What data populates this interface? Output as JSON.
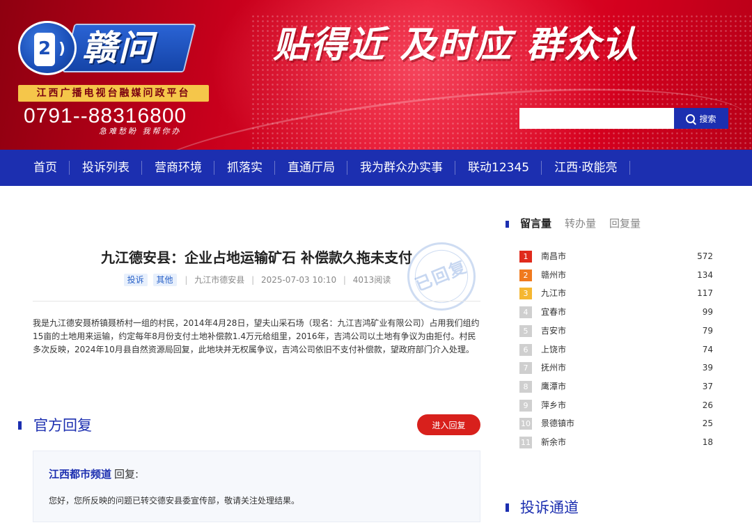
{
  "header": {
    "logo_num": "2",
    "logo_text": "赣问",
    "platform": "江西广播电视台融媒问政平台",
    "hotline": "0791--88316800",
    "hotline_sub": "急难愁盼  我帮你办",
    "slogan": "贴得近  及时应  群众认",
    "search": {
      "placeholder": "",
      "button_label": "搜索"
    }
  },
  "nav": [
    "首页",
    "投诉列表",
    "营商环境",
    "抓落实",
    "直通厅局",
    "我为群众办实事",
    "联动12345",
    "江西·政能亮"
  ],
  "article": {
    "title": "九江德安县：企业占地运输矿石 补偿款久拖未支付",
    "tags": [
      "投诉",
      "其他"
    ],
    "location": "九江市德安县",
    "datetime": "2025-07-03 10:10",
    "reads": "4013阅读",
    "stamp": "已回复",
    "body": "我是九江德安聂桥镇聂桥村一组的村民，2014年4月28日，望夫山采石场（现名：九江吉鸿矿业有限公司）占用我们组约15亩的土地用来运输，约定每年8月份支付土地补偿款1.4万元给组里，2016年，吉鸿公司以土地有争议为由拒付。村民多次反映，2024年10月县自然资源局回复，此地块并无权属争议，吉鸿公司依旧不支付补偿款，望政府部门介入处理。"
  },
  "official_reply": {
    "section_title": "官方回复",
    "button_label": "进入回复",
    "org": "江西都市频道",
    "reply_label": "回复:",
    "text": "您好，您所反映的问题已转交德安县委宣传部，敬请关注处理结果。"
  },
  "stats": {
    "tabs": [
      "留言量",
      "转办量",
      "回复量"
    ],
    "active_tab": 0,
    "ranking": [
      {
        "rank": "1",
        "city": "南昌市",
        "count": "572",
        "color": "#e02a1c"
      },
      {
        "rank": "2",
        "city": "赣州市",
        "count": "134",
        "color": "#f07a1e"
      },
      {
        "rank": "3",
        "city": "九江市",
        "count": "117",
        "color": "#f5b731"
      },
      {
        "rank": "4",
        "city": "宜春市",
        "count": "99",
        "color": "#cfcfcf"
      },
      {
        "rank": "5",
        "city": "吉安市",
        "count": "79",
        "color": "#cfcfcf"
      },
      {
        "rank": "6",
        "city": "上饶市",
        "count": "74",
        "color": "#cfcfcf"
      },
      {
        "rank": "7",
        "city": "抚州市",
        "count": "39",
        "color": "#cfcfcf"
      },
      {
        "rank": "8",
        "city": "鹰潭市",
        "count": "37",
        "color": "#cfcfcf"
      },
      {
        "rank": "9",
        "city": "萍乡市",
        "count": "26",
        "color": "#cfcfcf"
      },
      {
        "rank": "10",
        "city": "景德镇市",
        "count": "25",
        "color": "#cfcfcf"
      },
      {
        "rank": "11",
        "city": "新余市",
        "count": "18",
        "color": "#cfcfcf"
      }
    ]
  },
  "complaint_channel": {
    "title": "投诉通道"
  },
  "colors": {
    "brand_blue": "#1c2fb0",
    "brand_red": "#d8201c",
    "banner_red": "#e8102c"
  }
}
